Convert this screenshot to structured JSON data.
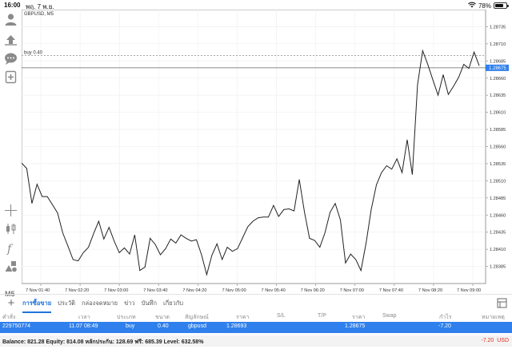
{
  "status_bar": {
    "time": "16:00",
    "date": "พฤ. 7 พ.ย.",
    "battery": "78%",
    "battery_level": 0.78
  },
  "left_toolbar": {
    "icons": [
      "account-icon",
      "trade-icon",
      "chat-icon",
      "new-order-icon",
      "crosshair-icon",
      "indicators-icon",
      "function-icon",
      "objects-icon"
    ],
    "timeframe": "M5"
  },
  "chart": {
    "symbol": "GBPUSD, M5",
    "order_line_label": "buy 0.40",
    "current_price_label": "1.28675",
    "colors": {
      "line": "#222222",
      "grid": "#eeeeee",
      "price_tag": "#2f80ec"
    }
  },
  "chart_data": {
    "type": "line",
    "title": "GBPUSD, M5",
    "x_tick_labels": [
      "7 Nov 01:40",
      "7 Nov 02:20",
      "7 Nov 03:00",
      "7 Nov 03:40",
      "7 Nov 04:20",
      "7 Nov 05:00",
      "7 Nov 05:40",
      "7 Nov 06:20",
      "7 Nov 07:00",
      "7 Nov 07:40",
      "7 Nov 08:20",
      "7 Nov 09:00"
    ],
    "y_tick_labels": [
      "1.28735",
      "1.28710",
      "1.28685",
      "1.28660",
      "1.28635",
      "1.28610",
      "1.28585",
      "1.28560",
      "1.28535",
      "1.28510",
      "1.28485",
      "1.28460",
      "1.28435",
      "1.28410",
      "1.28385"
    ],
    "ylim": [
      1.2836,
      1.2876
    ],
    "order_price": 1.28693,
    "current_price": 1.28675,
    "values": [
      1.28536,
      1.28528,
      1.28477,
      1.28505,
      1.28487,
      1.28487,
      1.28475,
      1.28463,
      1.28434,
      1.28415,
      1.28395,
      1.28393,
      1.28405,
      1.28413,
      1.28433,
      1.28451,
      1.28425,
      1.28442,
      1.28422,
      1.28405,
      1.28412,
      1.28403,
      1.28431,
      1.28379,
      1.28384,
      1.28426,
      1.28417,
      1.28402,
      1.28411,
      1.28425,
      1.28419,
      1.28431,
      1.28426,
      1.28422,
      1.28424,
      1.28402,
      1.28373,
      1.28401,
      1.28418,
      1.28395,
      1.28413,
      1.28407,
      1.28411,
      1.28427,
      1.28443,
      1.28451,
      1.28456,
      1.28457,
      1.28457,
      1.28474,
      1.28458,
      1.28468,
      1.28469,
      1.28466,
      1.28512,
      1.28465,
      1.28426,
      1.28423,
      1.28413,
      1.28434,
      1.28464,
      1.28477,
      1.28453,
      1.2839,
      1.28403,
      1.28395,
      1.28379,
      1.28419,
      1.28468,
      1.28504,
      1.28522,
      1.28532,
      1.28527,
      1.28542,
      1.28522,
      1.2857,
      1.28519,
      1.2865,
      1.287,
      1.2868,
      1.28657,
      1.28635,
      1.28665,
      1.28636,
      1.28648,
      1.28661,
      1.2868,
      1.28674,
      1.28698,
      1.28678
    ],
    "grid": true
  },
  "bottom_tabs": [
    "การซื้อขาย",
    "ประวัติ",
    "กล่องจดหมาย",
    "ข่าว",
    "บันทึก",
    "เกี่ยวกับ"
  ],
  "columns": [
    "คำสั่ง",
    "เวลา",
    "ประเภท",
    "ขนาด",
    "สัญลักษณ์",
    "ราคา",
    "S/L",
    "T/P",
    "ราคา",
    "Swap",
    "กำไร",
    "หมายเหตุ"
  ],
  "order": {
    "ticket": "229750774",
    "time": "11.07 08:49",
    "type": "buy",
    "size": "0.40",
    "symbol": "gbpusd",
    "open_price": "1.28693",
    "current_price": "1.28675",
    "profit": "-7.20"
  },
  "balance": {
    "text": "Balance: 821.28 Equity: 814.08 หลักประกัน: 128.69 ฟรี: 685.39 Level: 632.58%",
    "profit": "-7.20",
    "currency": "USD"
  }
}
